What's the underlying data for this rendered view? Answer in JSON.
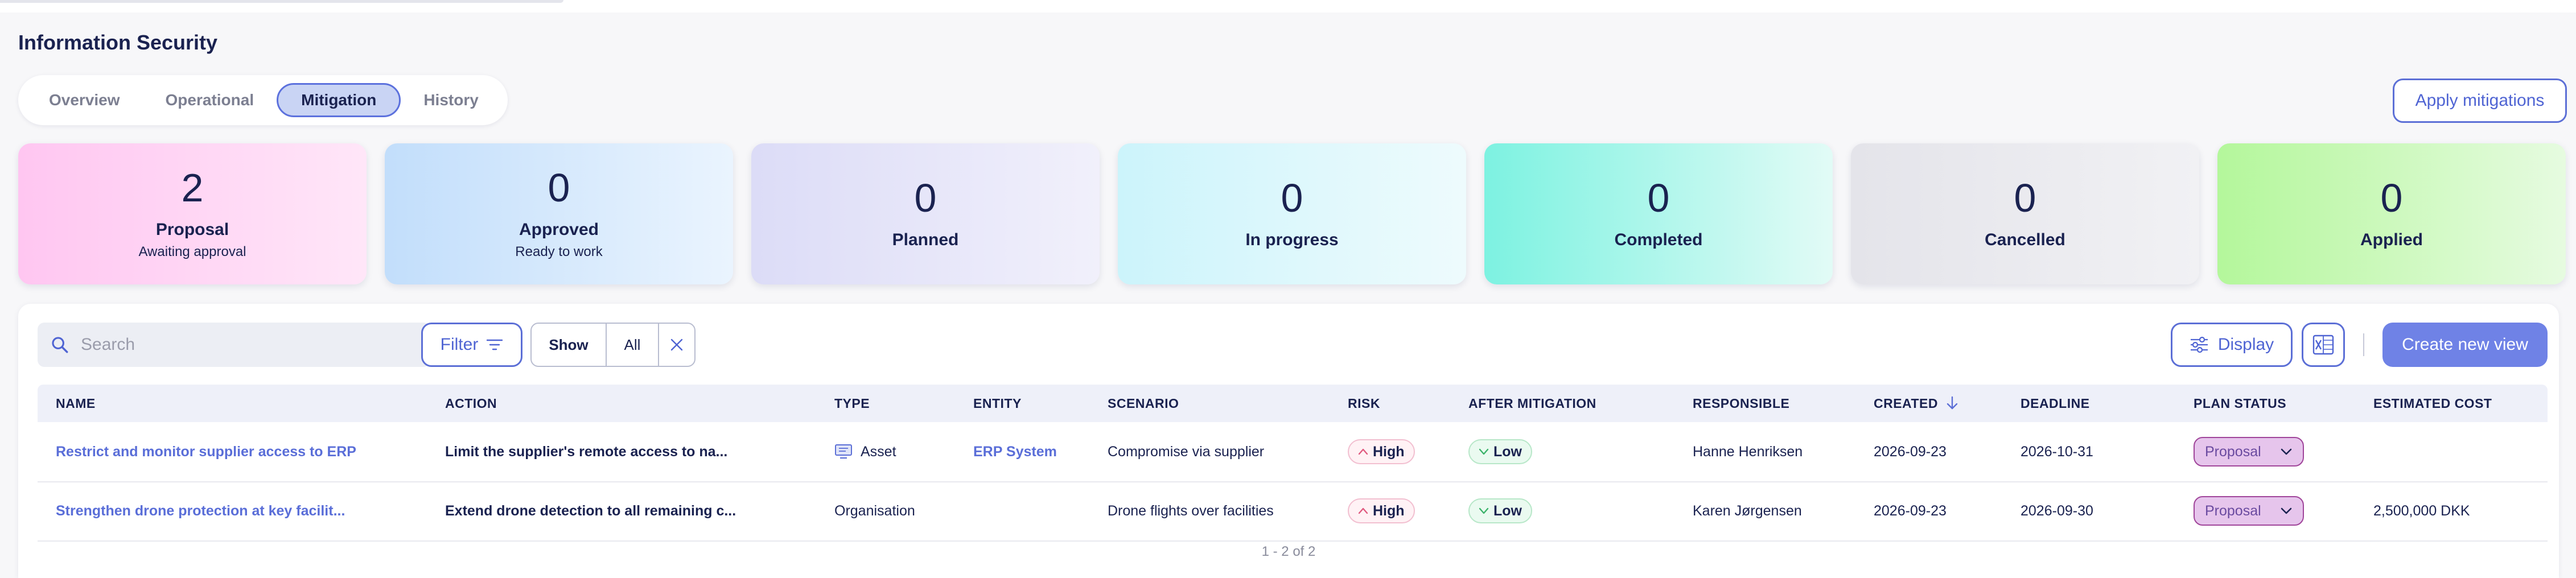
{
  "page": {
    "title": "Information Security"
  },
  "tabs": [
    {
      "label": "Overview",
      "active": false
    },
    {
      "label": "Operational",
      "active": false
    },
    {
      "label": "Mitigation",
      "active": true
    },
    {
      "label": "History",
      "active": false
    }
  ],
  "apply_button": "Apply mitigations",
  "cards": [
    {
      "count": "2",
      "label": "Proposal",
      "sub": "Awaiting approval",
      "gradient": [
        "#ffc6f1",
        "#ffe6f8"
      ]
    },
    {
      "count": "0",
      "label": "Approved",
      "sub": "Ready to work",
      "gradient": [
        "#c2defb",
        "#eaf4fe"
      ]
    },
    {
      "count": "0",
      "label": "Planned",
      "sub": "",
      "gradient": [
        "#dcdcf7",
        "#f1f0fb"
      ]
    },
    {
      "count": "0",
      "label": "In progress",
      "sub": "",
      "gradient": [
        "#ccf4fb",
        "#eefbfd"
      ]
    },
    {
      "count": "0",
      "label": "Completed",
      "sub": "",
      "gradient": [
        "#7df2e1",
        "#e2fbf6"
      ]
    },
    {
      "count": "0",
      "label": "Cancelled",
      "sub": "",
      "gradient": [
        "#e4e4ea",
        "#f1f1f4"
      ]
    },
    {
      "count": "0",
      "label": "Applied",
      "sub": "",
      "gradient": [
        "#b4f79b",
        "#e6fbe0"
      ]
    }
  ],
  "toolbar": {
    "search_placeholder": "Search",
    "filter_label": "Filter",
    "show_label": "Show",
    "all_label": "All",
    "display_label": "Display",
    "create_label": "Create new view"
  },
  "table": {
    "columns": [
      "NAME",
      "ACTION",
      "TYPE",
      "ENTITY",
      "SCENARIO",
      "RISK",
      "AFTER MITIGATION",
      "RESPONSIBLE",
      "CREATED",
      "DEADLINE",
      "PLAN STATUS",
      "ESTIMATED COST"
    ],
    "rows": [
      {
        "name": "Restrict and monitor supplier access to ERP",
        "action": "Limit the supplier's remote access to na...",
        "type": "Asset",
        "entity": "ERP System",
        "scenario": "Compromise via supplier",
        "risk": "High",
        "after": "Low",
        "responsible": "Hanne Henriksen",
        "created": "2026-09-23",
        "deadline": "2026-10-31",
        "status": "Proposal",
        "cost": ""
      },
      {
        "name": "Strengthen drone protection at key facilit...",
        "action": "Extend drone detection to all remaining c...",
        "type": "Organisation",
        "entity": "",
        "scenario": "Drone flights over facilities",
        "risk": "High",
        "after": "Low",
        "responsible": "Karen Jørgensen",
        "created": "2026-09-23",
        "deadline": "2026-09-30",
        "status": "Proposal",
        "cost": "2,500,000 DKK"
      }
    ]
  },
  "pager": "1 - 2 of 2",
  "colors": {
    "accent": "#5c6fd6",
    "primary_button": "#6f82e6",
    "status_border": "#a0459a"
  }
}
